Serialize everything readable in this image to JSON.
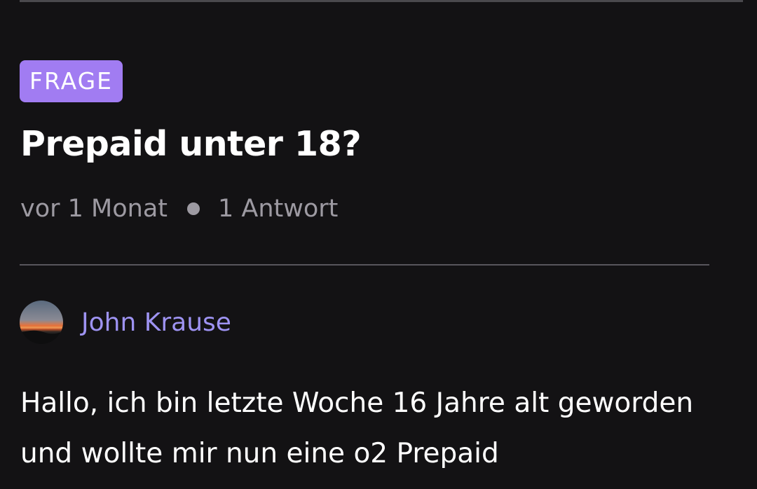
{
  "post": {
    "tag": "FRAGE",
    "title": "Prepaid unter 18?",
    "meta": {
      "age": "vor 1 Monat",
      "answers": "1 Antwort"
    },
    "author": {
      "name": "John Krause",
      "avatar_icon": "sunset-photo-avatar"
    },
    "body": "Hallo, ich bin letzte Woche 16 Jahre alt geworden und wollte mir nun eine o2 Prepaid"
  },
  "colors": {
    "background": "#131214",
    "tag": "#a17cf2",
    "author_link": "#9e93f2",
    "meta_text": "#9d9aa2"
  }
}
